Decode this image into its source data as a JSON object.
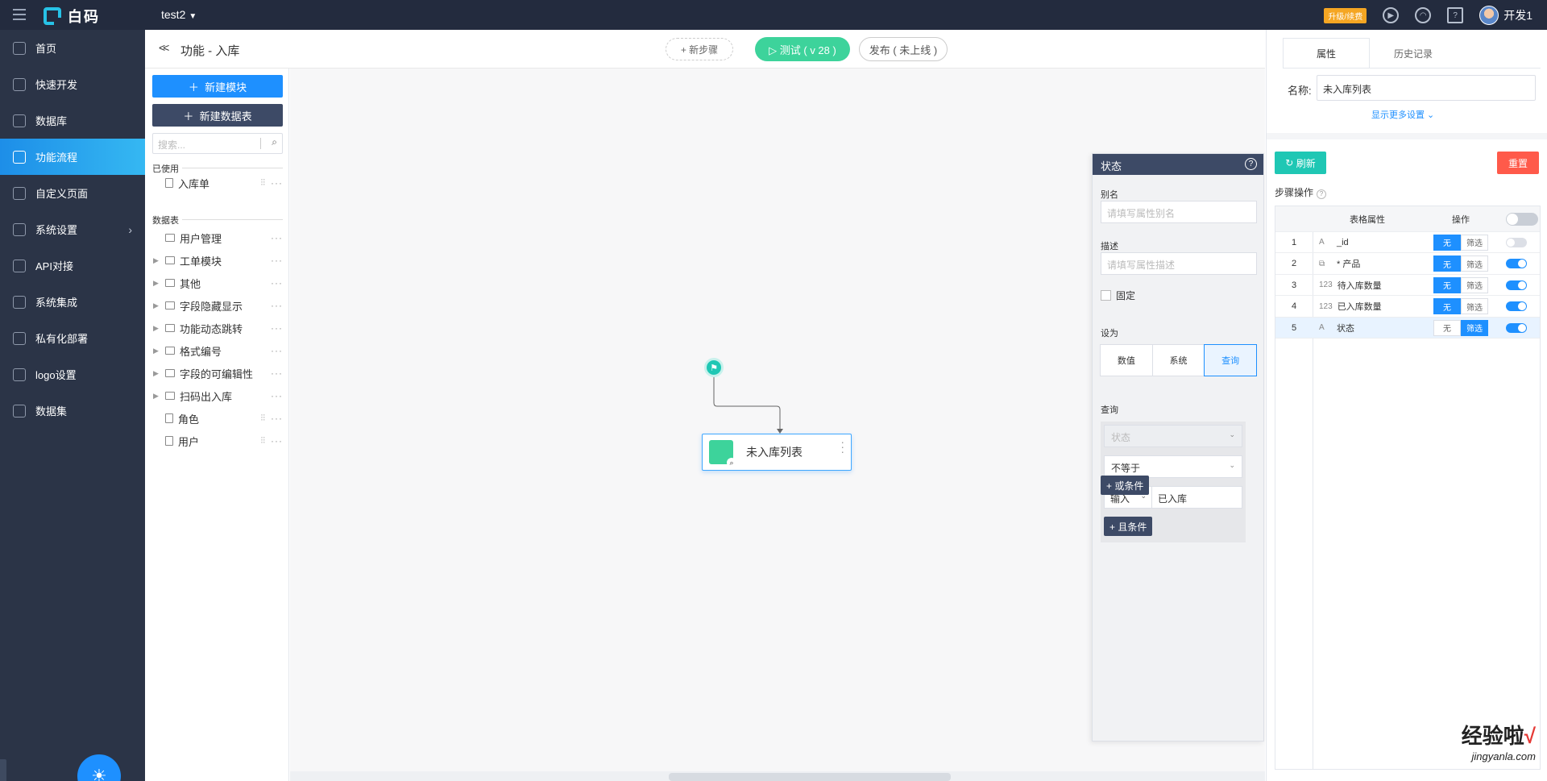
{
  "topbar": {
    "logo_text": "白码",
    "project": "test2",
    "upgrade_label": "升级/续费",
    "user_name": "开发1"
  },
  "sidebar": {
    "items": [
      {
        "label": "首页",
        "icon": "home-icon"
      },
      {
        "label": "快速开发",
        "icon": "cube-icon"
      },
      {
        "label": "数据库",
        "icon": "database-icon"
      },
      {
        "label": "功能流程",
        "icon": "flow-icon",
        "active": true
      },
      {
        "label": "自定义页面",
        "icon": "page-icon"
      },
      {
        "label": "系统设置",
        "icon": "chart-icon",
        "has_arrow": true
      },
      {
        "label": "API对接",
        "icon": "api-icon"
      },
      {
        "label": "系统集成",
        "icon": "layers-icon"
      },
      {
        "label": "私有化部署",
        "icon": "deploy-icon"
      },
      {
        "label": "logo设置",
        "icon": "logo-icon"
      },
      {
        "label": "数据集",
        "icon": "dataset-icon"
      }
    ]
  },
  "header": {
    "title": "功能 - 入库",
    "new_step": "+ 新步骤",
    "test": "▷ 测试 ( v 28 )",
    "publish": "发布 ( 未上线 )"
  },
  "modules": {
    "new_module": "新建模块",
    "new_table": "新建数据表",
    "search_placeholder": "搜索...",
    "used_label": "已使用",
    "used_items": [
      {
        "label": "入库单"
      }
    ],
    "tables_label": "数据表",
    "tables": [
      {
        "label": "用户管理",
        "type": "folder",
        "expandable": false
      },
      {
        "label": "工单模块",
        "type": "folder",
        "expandable": true
      },
      {
        "label": "其他",
        "type": "folder",
        "expandable": true
      },
      {
        "label": "字段隐藏显示",
        "type": "folder",
        "expandable": true
      },
      {
        "label": "功能动态跳转",
        "type": "folder",
        "expandable": true
      },
      {
        "label": "格式编号",
        "type": "folder",
        "expandable": true
      },
      {
        "label": "字段的可编辑性",
        "type": "folder",
        "expandable": true
      },
      {
        "label": "扫码出入库",
        "type": "folder",
        "expandable": true
      },
      {
        "label": "角色",
        "type": "doc",
        "expandable": false
      },
      {
        "label": "用户",
        "type": "doc",
        "expandable": false
      }
    ]
  },
  "canvas": {
    "node_label": "未入库列表"
  },
  "status_panel": {
    "title": "状态",
    "alias_label": "别名",
    "alias_placeholder": "请填写属性别名",
    "desc_label": "描述",
    "desc_placeholder": "请填写属性描述",
    "fixed_label": "固定",
    "set_as_label": "设为",
    "set_as_options": [
      "数值",
      "系统",
      "查询"
    ],
    "set_as_selected": "查询",
    "query_label": "查询",
    "query_field": "状态",
    "query_operator": "不等于",
    "query_input_type": "输入",
    "query_value": "已入库",
    "and_condition": "+ 且条件",
    "or_condition": "+ 或条件"
  },
  "right_panel": {
    "tabs": [
      "属性",
      "历史记录"
    ],
    "name_label": "名称:",
    "name_value": "未入库列表",
    "more_settings": "显示更多设置 ⌄",
    "refresh": "刷新",
    "reset": "重置",
    "step_ops": "步骤操作",
    "table_header": {
      "attr": "表格属性",
      "op": "操作"
    },
    "rows": [
      {
        "idx": "1",
        "type_icon": "A",
        "name": "_id",
        "op_none": "无",
        "op_filter": "筛选",
        "selected_op": "none",
        "enabled": false,
        "selected": false
      },
      {
        "idx": "2",
        "type_icon": "⧉",
        "name": "* 产品",
        "op_none": "无",
        "op_filter": "筛选",
        "selected_op": "none",
        "enabled": true,
        "selected": false
      },
      {
        "idx": "3",
        "type_icon": "123",
        "name": "待入库数量",
        "op_none": "无",
        "op_filter": "筛选",
        "selected_op": "none",
        "enabled": true,
        "selected": false
      },
      {
        "idx": "4",
        "type_icon": "123",
        "name": "已入库数量",
        "op_none": "无",
        "op_filter": "筛选",
        "selected_op": "none",
        "enabled": true,
        "selected": false
      },
      {
        "idx": "5",
        "type_icon": "A",
        "name": "状态",
        "op_none": "无",
        "op_filter": "筛选",
        "selected_op": "filter",
        "enabled": true,
        "selected": true
      }
    ]
  },
  "watermark": {
    "text": "经验啦",
    "check": "√",
    "sub": "jingyanla.com"
  },
  "colors": {
    "sidebar_bg": "#2b3447",
    "topbar_bg": "#232b3e",
    "accent": "#1e90ff",
    "green": "#3dd39b",
    "teal": "#1fc7b4",
    "danger": "#ff5a4a"
  }
}
